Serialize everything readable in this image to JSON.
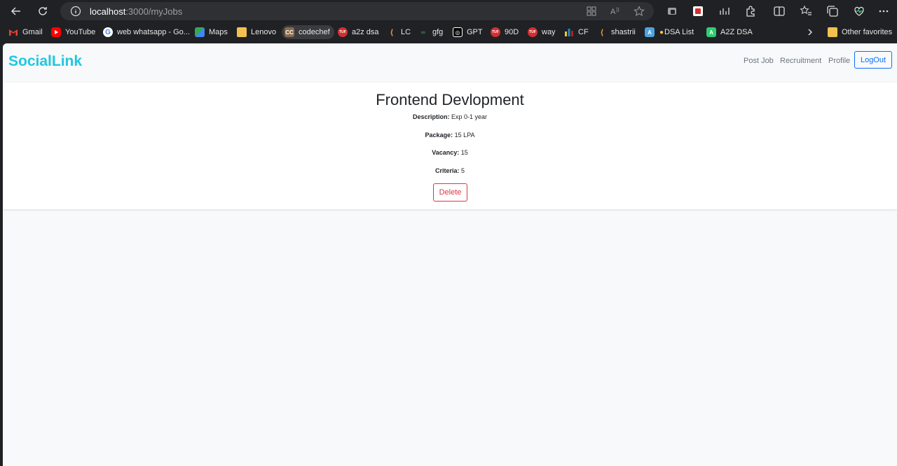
{
  "browser": {
    "url_host": "localhost",
    "url_path": ":3000/myJobs",
    "bookmarks": [
      {
        "label": "Gmail",
        "icon": "gmail-icon",
        "color": "#ea4335"
      },
      {
        "label": "YouTube",
        "icon": "youtube-icon",
        "color": "#ff0000"
      },
      {
        "label": "web whatsapp - Go...",
        "icon": "google-icon",
        "color": "#ffffff"
      },
      {
        "label": "Maps",
        "icon": "maps-icon",
        "color": "#34a853"
      },
      {
        "label": "Lenovo",
        "icon": "folder-icon",
        "color": "#f2c14e"
      },
      {
        "label": "codechef",
        "icon": "codechef-icon",
        "color": "#8b6b4a"
      },
      {
        "label": "a2z dsa",
        "icon": "tuf-icon",
        "color": "#d32f2f"
      },
      {
        "label": "LC",
        "icon": "leetcode-icon",
        "color": "#f0a030"
      },
      {
        "label": "gfg",
        "icon": "gfg-icon",
        "color": "#2f8d46"
      },
      {
        "label": "GPT",
        "icon": "chatgpt-icon",
        "color": "#ffffff"
      },
      {
        "label": "90D",
        "icon": "tuf-icon",
        "color": "#d32f2f"
      },
      {
        "label": "way",
        "icon": "tuf-icon",
        "color": "#d32f2f"
      },
      {
        "label": "CF",
        "icon": "codeforces-icon",
        "color": "#1f8acb"
      },
      {
        "label": "shastrii",
        "icon": "leetcode-icon",
        "color": "#f0a030"
      },
      {
        "label": "DSA List",
        "icon": "dsa-list-icon",
        "color": "#4ea3e0"
      },
      {
        "label": "A2Z DSA",
        "icon": "a2z-icon",
        "color": "#2ecc71"
      }
    ],
    "other_favorites": "Other favorites"
  },
  "navbar": {
    "brand": "SocialLink",
    "links": [
      "Post Job",
      "Recruitment",
      "Profile"
    ],
    "logout": "LogOut"
  },
  "job": {
    "title": "Frontend Devlopment",
    "description_label": "Description:",
    "description": "Exp 0-1 year",
    "package_label": "Package:",
    "package": "15 LPA",
    "vacancy_label": "Vacancy:",
    "vacancy": "15",
    "criteria_label": "Criteria:",
    "criteria": "5",
    "delete_label": "Delete"
  },
  "colors": {
    "brand": "#1ec8e0",
    "primary": "#0d6efd",
    "danger": "#dc3545"
  }
}
